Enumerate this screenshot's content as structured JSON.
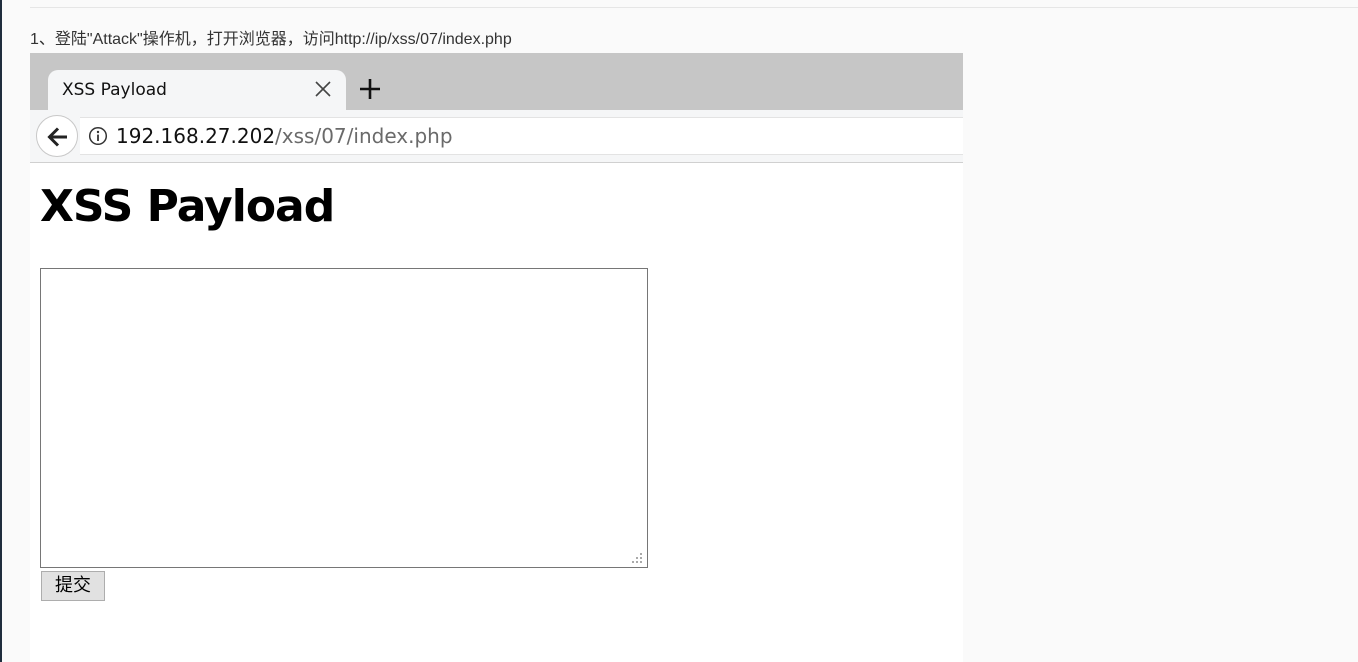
{
  "instruction": {
    "text": "1、登陆\"Attack\"操作机，打开浏览器，访问http://ip/xss/07/index.php"
  },
  "browser": {
    "tab": {
      "title": "XSS Payload",
      "close_icon": "close-icon"
    },
    "new_tab_icon": "plus-icon",
    "back_icon": "back-arrow-icon",
    "site_info_icon": "info-icon",
    "url": {
      "host": "192.168.27.202",
      "path": "/xss/07/index.php"
    }
  },
  "page": {
    "heading": "XSS Payload",
    "textarea": {
      "value": "",
      "placeholder": ""
    },
    "submit_label": "提交"
  },
  "colors": {
    "tabstrip": "#c6c6c6",
    "toolbar": "#f5f6f7",
    "page_background": "#ffffff",
    "document_background": "#fafafa"
  }
}
